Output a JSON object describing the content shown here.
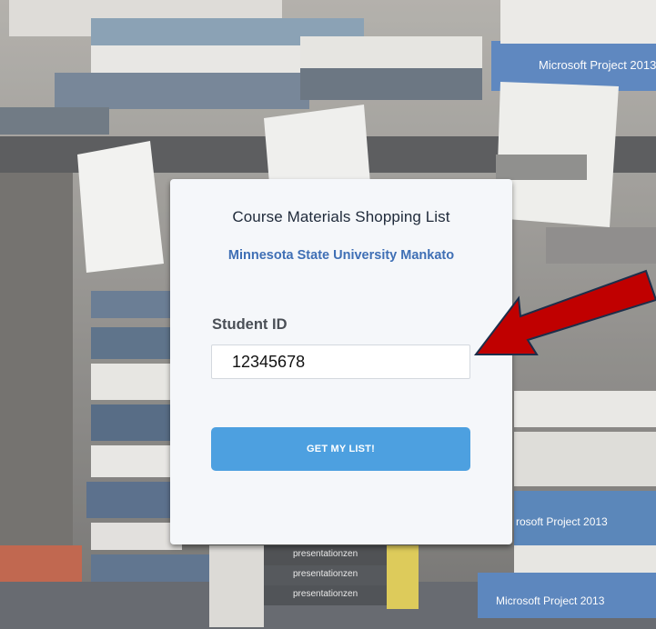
{
  "modal": {
    "title": "Course Materials Shopping List",
    "subtitle": "Minnesota State University Mankato",
    "field_label": "Student ID",
    "student_id_value": "12345678",
    "submit_label": "GET MY LIST!"
  },
  "background": {
    "book_labels": [
      "Microsoft Project 2013",
      "presentationzen"
    ]
  },
  "annotation": {
    "arrow_color": "#c00000",
    "arrow_target": "student-id-input"
  },
  "colors": {
    "accent_button": "#4da0e0",
    "subtitle_link": "#3f6fb5",
    "card_bg": "#f5f7fa"
  }
}
